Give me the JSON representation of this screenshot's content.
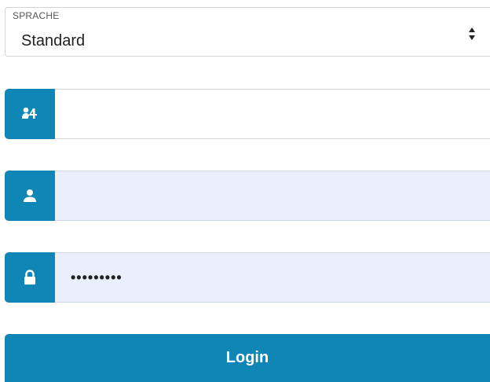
{
  "language": {
    "label": "SPRACHE",
    "selected": "Standard",
    "icon": "sort-arrows-icon"
  },
  "fields": {
    "organization": {
      "icon": "organization-icon",
      "value": "",
      "placeholder": ""
    },
    "username": {
      "icon": "user-icon",
      "value": "",
      "placeholder": ""
    },
    "password": {
      "icon": "lock-icon",
      "value": "•••••••••",
      "placeholder": ""
    }
  },
  "login": {
    "label": "Login"
  },
  "colors": {
    "accent": "#0f86b6",
    "autofill_bg": "#e9effd",
    "border": "#d6d6d6"
  }
}
